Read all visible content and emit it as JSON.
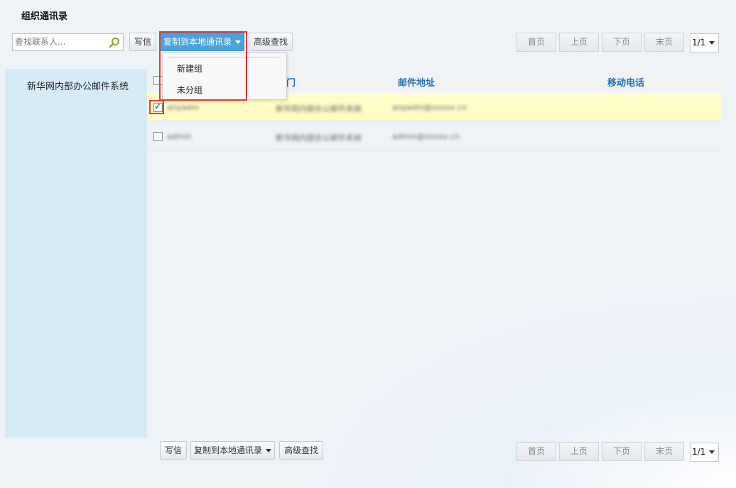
{
  "page": {
    "title": "组织通讯录"
  },
  "search": {
    "placeholder": "查找联系人..."
  },
  "toolbar": {
    "write_label": "写信",
    "copy_label": "复制到本地通讯录",
    "advanced_label": "高级查找"
  },
  "pagination": {
    "first": "首页",
    "prev": "上页",
    "next": "下页",
    "last": "末页",
    "page_value": "1/1"
  },
  "dropdown": {
    "items": [
      "新建组",
      "未分组"
    ]
  },
  "sidebar": {
    "items": [
      {
        "label": "新华网内部办公邮件系统"
      }
    ]
  },
  "table": {
    "columns": {
      "dept": "部门",
      "email": "邮件地址",
      "mobile": "移动电话"
    },
    "rows": [
      {
        "name": "anyadm",
        "dept": "新华网内部办公邮件系统",
        "email": "anyadm@xxxxx.cn",
        "checked": true
      },
      {
        "name": "admin",
        "dept": "新华网内部办公邮件系统",
        "email": "admin@xxxxx.cn",
        "checked": false
      }
    ]
  },
  "colors": {
    "accent": "#4aa3d8",
    "header_text": "#2a6fb3",
    "selected_row": "#fffdc6",
    "highlight": "#e03a3a",
    "sidebar_bg": "#d6ebf8"
  }
}
